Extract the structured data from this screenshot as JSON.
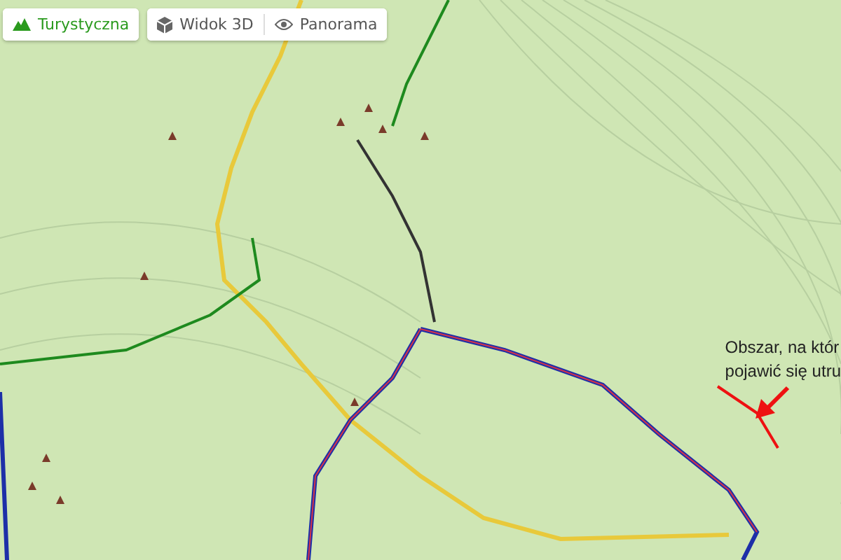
{
  "tabs": [
    {
      "label": "Turystyczna",
      "kind": "hiking",
      "selected": true
    },
    {
      "label": "Widok 3D",
      "kind": "cube",
      "selected": false
    },
    {
      "label": "Panorama",
      "kind": "eye",
      "selected": false
    }
  ],
  "annotation": {
    "lines": [
      "Obszar, na któr",
      "pojawić się utru"
    ]
  }
}
